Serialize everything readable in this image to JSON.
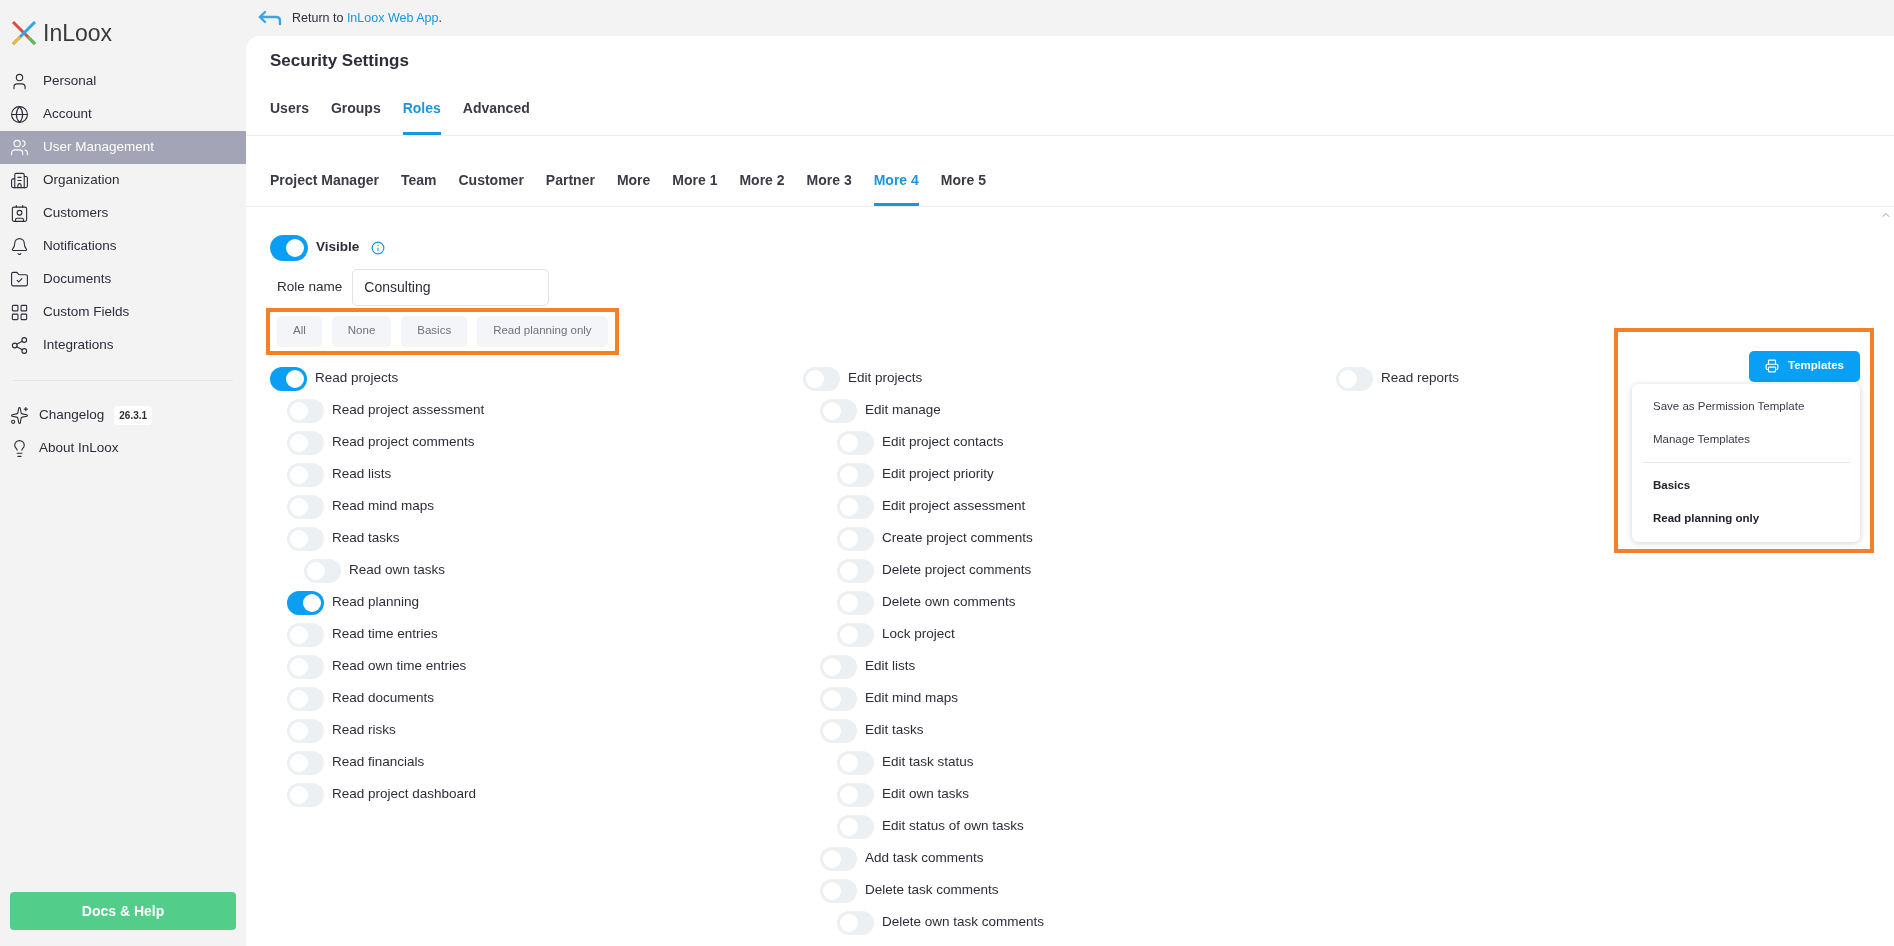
{
  "logo": {
    "text": "InLoox"
  },
  "sidebar": {
    "items": [
      {
        "label": "Personal",
        "selected": false
      },
      {
        "label": "Account",
        "selected": false
      },
      {
        "label": "User Management",
        "selected": true
      },
      {
        "label": "Organization",
        "selected": false
      },
      {
        "label": "Customers",
        "selected": false
      },
      {
        "label": "Notifications",
        "selected": false
      },
      {
        "label": "Documents",
        "selected": false
      },
      {
        "label": "Custom Fields",
        "selected": false
      },
      {
        "label": "Integrations",
        "selected": false
      }
    ],
    "extra": [
      {
        "label": "Changelog",
        "badge": "26.3.1"
      },
      {
        "label": "About InLoox"
      }
    ],
    "help_button": "Docs & Help"
  },
  "return_link": {
    "text": "Return to ",
    "link": "InLoox Web App",
    "after": "."
  },
  "title": "Security Settings",
  "tabs": [
    {
      "label": "Users",
      "selected": false
    },
    {
      "label": "Groups",
      "selected": false
    },
    {
      "label": "Roles",
      "selected": true
    },
    {
      "label": "Advanced",
      "selected": false
    }
  ],
  "role_tabs": [
    {
      "label": "Project Manager",
      "selected": false
    },
    {
      "label": "Team",
      "selected": false
    },
    {
      "label": "Customer",
      "selected": false
    },
    {
      "label": "Partner",
      "selected": false
    },
    {
      "label": "More",
      "selected": false
    },
    {
      "label": "More 1",
      "selected": false
    },
    {
      "label": "More 2",
      "selected": false
    },
    {
      "label": "More 3",
      "selected": false
    },
    {
      "label": "More 4",
      "selected": true
    },
    {
      "label": "More 5",
      "selected": false
    }
  ],
  "visible": {
    "label": "Visible",
    "on": true
  },
  "role_name": {
    "label": "Role name",
    "value": "Consulting"
  },
  "presets": [
    "All",
    "None",
    "Basics",
    "Read planning only"
  ],
  "templates": {
    "button": "Templates",
    "menu": [
      {
        "label": "Save as Permission Template",
        "kind": "action"
      },
      {
        "label": "Manage Templates",
        "kind": "action"
      },
      {
        "kind": "divider"
      },
      {
        "label": "Basics",
        "kind": "template"
      },
      {
        "label": "Read planning only",
        "kind": "template"
      }
    ]
  },
  "permissions": [
    [
      {
        "label": "Read projects",
        "on": true,
        "children": [
          {
            "label": "Read project assessment",
            "on": false
          },
          {
            "label": "Read project comments",
            "on": false
          },
          {
            "label": "Read lists",
            "on": false
          },
          {
            "label": "Read mind maps",
            "on": false
          },
          {
            "label": "Read tasks",
            "on": false,
            "children": [
              {
                "label": "Read own tasks",
                "on": false
              }
            ]
          },
          {
            "label": "Read planning",
            "on": true
          },
          {
            "label": "Read time entries",
            "on": false
          },
          {
            "label": "Read own time entries",
            "on": false
          },
          {
            "label": "Read documents",
            "on": false
          },
          {
            "label": "Read risks",
            "on": false
          },
          {
            "label": "Read financials",
            "on": false
          },
          {
            "label": "Read project dashboard",
            "on": false
          }
        ]
      }
    ],
    [
      {
        "label": "Edit projects",
        "on": false,
        "children": [
          {
            "label": "Edit manage",
            "on": false,
            "children": [
              {
                "label": "Edit project contacts",
                "on": false
              },
              {
                "label": "Edit project priority",
                "on": false
              },
              {
                "label": "Edit project assessment",
                "on": false
              },
              {
                "label": "Create project comments",
                "on": false
              },
              {
                "label": "Delete project comments",
                "on": false
              },
              {
                "label": "Delete own comments",
                "on": false
              },
              {
                "label": "Lock project",
                "on": false
              }
            ]
          },
          {
            "label": "Edit lists",
            "on": false
          },
          {
            "label": "Edit mind maps",
            "on": false
          },
          {
            "label": "Edit tasks",
            "on": false,
            "children": [
              {
                "label": "Edit task status",
                "on": false
              },
              {
                "label": "Edit own tasks",
                "on": false
              },
              {
                "label": "Edit status of own tasks",
                "on": false
              }
            ]
          },
          {
            "label": "Add task comments",
            "on": false
          },
          {
            "label": "Delete task comments",
            "on": false,
            "children": [
              {
                "label": "Delete own task comments",
                "on": false
              }
            ]
          }
        ]
      }
    ],
    [
      {
        "label": "Read reports",
        "on": false
      }
    ]
  ]
}
